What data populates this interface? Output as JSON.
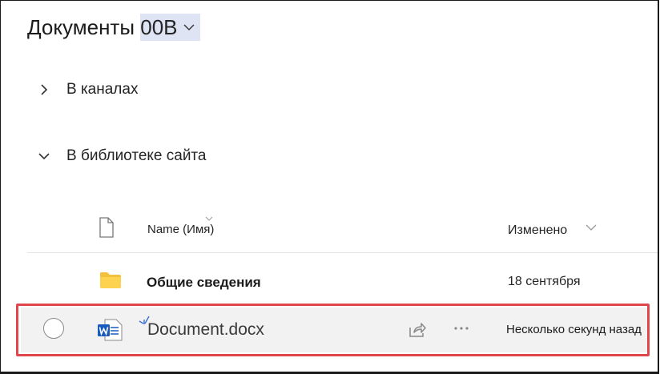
{
  "library": {
    "title": "Документы 00B"
  },
  "groups": {
    "channels": "В каналах",
    "site_library": "В библиотеке сайта"
  },
  "columns": {
    "name": "Name (Имя)",
    "modified": "Изменено"
  },
  "rows": [
    {
      "name": "Общие сведения",
      "modified": "18 сентября",
      "icon": "folder-icon"
    },
    {
      "name": "Document.docx",
      "modified": "Несколько секунд назад",
      "icon": "word-doc-icon"
    }
  ],
  "colors": {
    "highlight_border": "#e0474c",
    "title_highlight": "#dfe4f5",
    "folder": "#f3c13b",
    "word_blue": "#185abd"
  }
}
